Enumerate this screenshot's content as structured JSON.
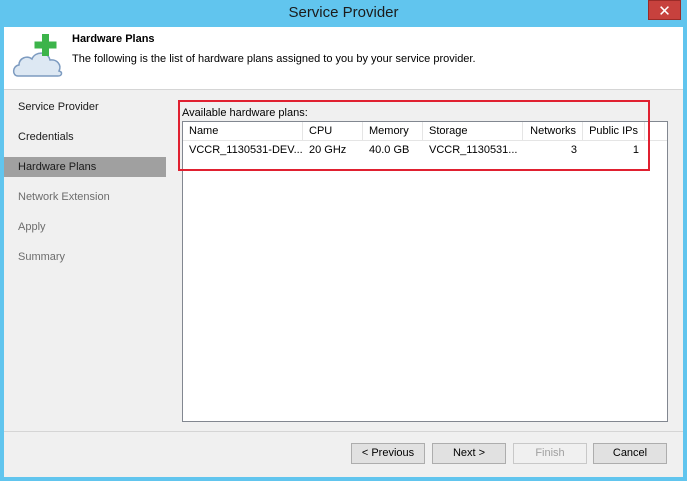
{
  "window": {
    "title": "Service Provider",
    "close_glyph": "✕"
  },
  "header": {
    "icon": "cloud-plus-icon",
    "title": "Hardware Plans",
    "description": "The following is the list of hardware plans assigned to you by your service provider."
  },
  "nav": {
    "items": [
      {
        "label": "Service Provider",
        "state": "normal"
      },
      {
        "label": "Credentials",
        "state": "normal"
      },
      {
        "label": "Hardware Plans",
        "state": "active"
      },
      {
        "label": "Network Extension",
        "state": "disabled"
      },
      {
        "label": "Apply",
        "state": "disabled"
      },
      {
        "label": "Summary",
        "state": "disabled"
      }
    ]
  },
  "plans": {
    "label": "Available hardware plans:",
    "columns": [
      "Name",
      "CPU",
      "Memory",
      "Storage",
      "Networks",
      "Public IPs"
    ],
    "rows": [
      {
        "name": "VCCR_1130531-DEV...",
        "cpu": "20 GHz",
        "memory": "40.0 GB",
        "storage": "VCCR_1130531...",
        "networks": "3",
        "public_ips": "1"
      }
    ]
  },
  "buttons": {
    "previous": "< Previous",
    "next": "Next >",
    "finish": "Finish",
    "cancel": "Cancel"
  },
  "colors": {
    "titlebar": "#61c5ee",
    "close": "#c7413d",
    "highlight": "#e02030",
    "nav_active": "#a0a0a0",
    "icon_green": "#3cb44a"
  }
}
